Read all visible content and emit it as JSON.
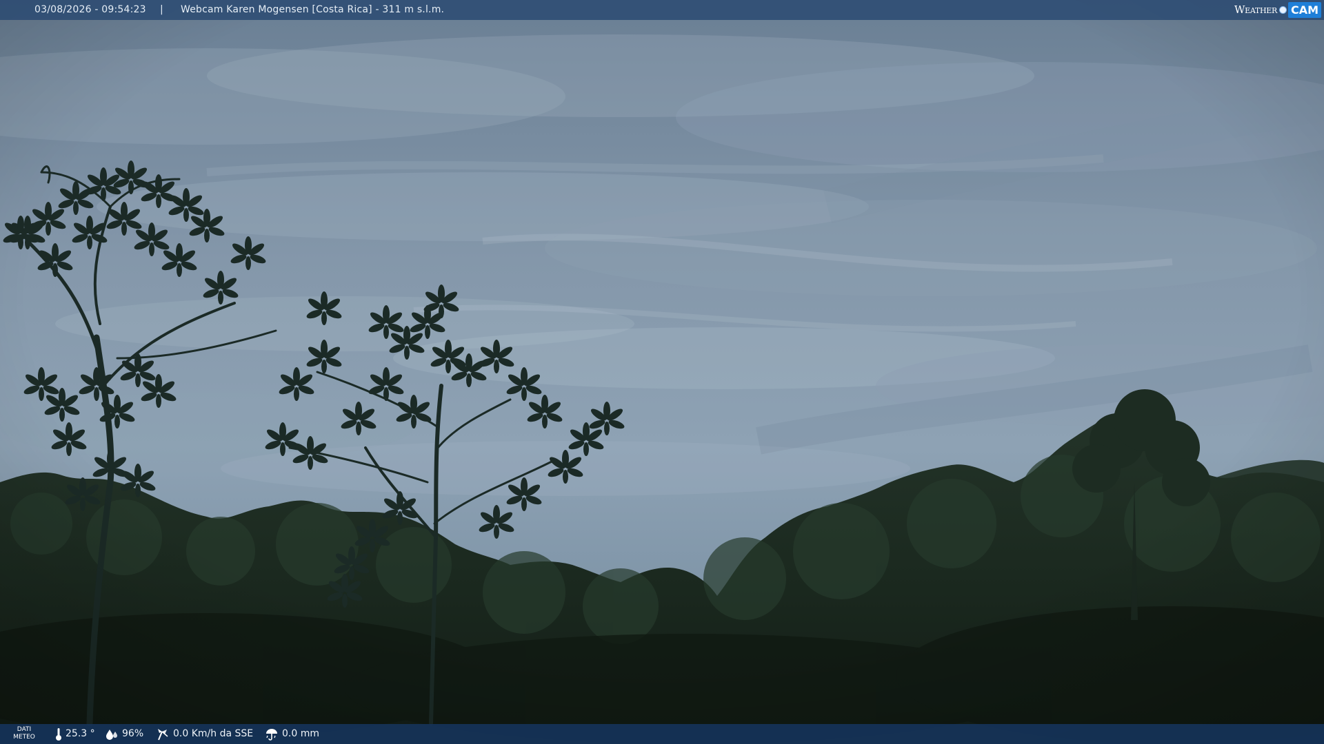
{
  "header": {
    "timestamp": "03/08/2026 - 09:54:23",
    "separator": "|",
    "title": "Webcam Karen Mogensen [Costa Rica]  - 311 m s.l.m.",
    "logo_word": "Weather",
    "logo_badge": "CAM"
  },
  "footer": {
    "dati_label_line1": "DATI",
    "dati_label_line2": "METEO",
    "temperature": "25.3 °",
    "humidity": "96%",
    "wind": "0.0 Km/h da SSE",
    "rain": "0.0 mm",
    "icons": [
      "thermometer-icon",
      "humidity-icon",
      "wind-icon",
      "rain-icon"
    ]
  },
  "colors": {
    "sky_top": "#6e8398",
    "sky_mid": "#8da1b4",
    "sky_low": "#7c92a6",
    "foliage_dark": "#16221a",
    "foliage_mid": "#1f2e22",
    "tree_silhouette": "#1b2a26",
    "top_bar": "#284870",
    "bottom_bar": "#16345c",
    "logo_accent": "#1f7fd8"
  }
}
